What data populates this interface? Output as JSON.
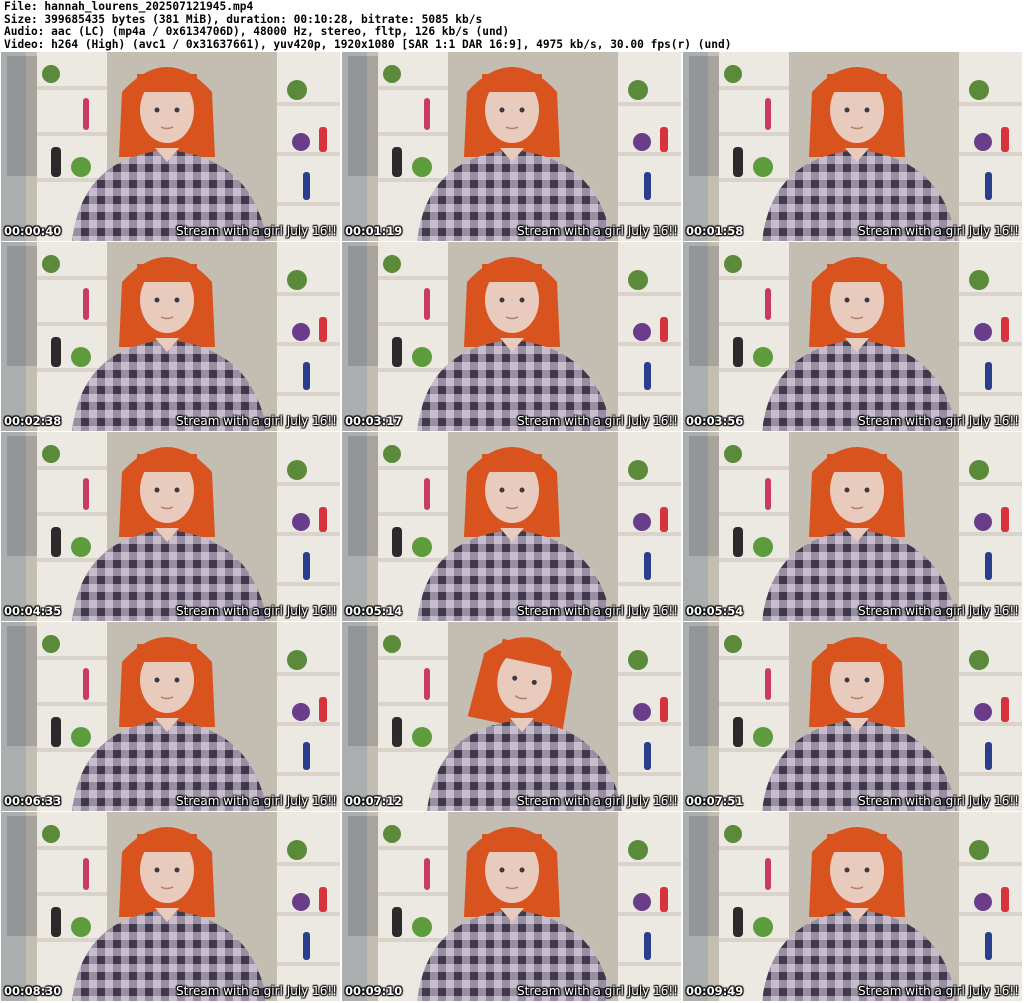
{
  "header": {
    "file": "File: hannah_lourens_202507121945.mp4",
    "size": "Size: 399685435 bytes (381 MiB), duration: 00:10:28, bitrate: 5085 kb/s",
    "audio": "Audio: aac (LC) (mp4a / 0x6134706D), 48000 Hz, stereo, fltp, 126 kb/s (und)",
    "video": "Video: h264 (High) (avc1 / 0x31637661), yuv420p, 1920x1080 [SAR 1:1 DAR 16:9], 4975 kb/s, 30.00 fps(r) (und)"
  },
  "caption": "Stream with a girl July 16!!",
  "frames": [
    {
      "time": "00:00:40"
    },
    {
      "time": "00:01:19"
    },
    {
      "time": "00:01:58"
    },
    {
      "time": "00:02:38"
    },
    {
      "time": "00:03:17"
    },
    {
      "time": "00:03:56"
    },
    {
      "time": "00:04:35"
    },
    {
      "time": "00:05:14"
    },
    {
      "time": "00:05:54"
    },
    {
      "time": "00:06:33"
    },
    {
      "time": "00:07:12"
    },
    {
      "time": "00:07:51"
    },
    {
      "time": "00:08:30"
    },
    {
      "time": "00:09:10"
    },
    {
      "time": "00:09:49"
    }
  ],
  "colors": {
    "wall": "#c4bdb2",
    "shelf": "#ece8e2",
    "hair": "#d9531f",
    "shirt_dark": "#4a4659",
    "shirt_light": "#c8b9cc",
    "skin": "#e9cbbd"
  }
}
